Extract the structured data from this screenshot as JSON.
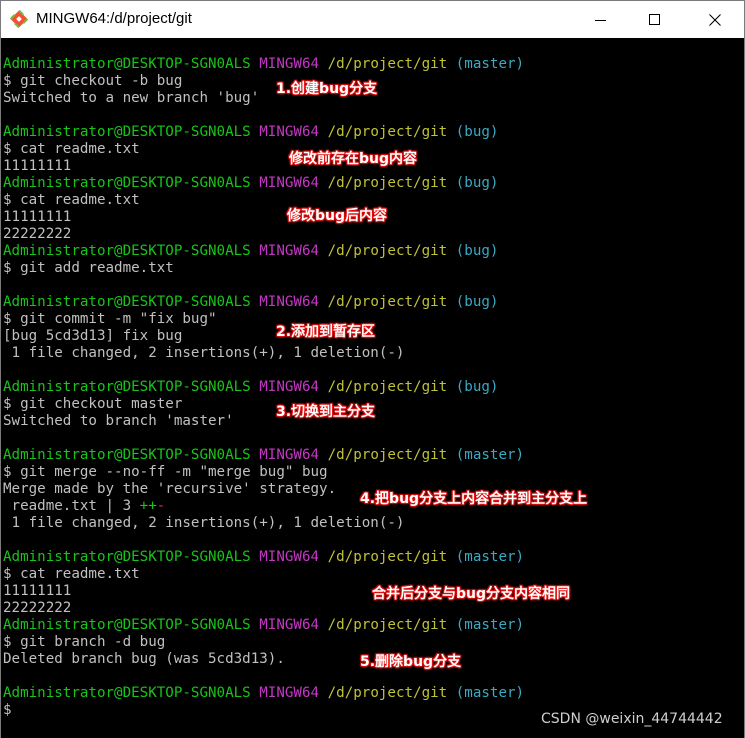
{
  "window": {
    "title": "MINGW64:/d/project/git"
  },
  "colors": {
    "user": "#18c418",
    "shell": "#c437c4",
    "path": "#c1c136",
    "branch": "#3aa9c4",
    "text": "#c0c0c0",
    "annotation_outline": "#e01010"
  },
  "prompt": {
    "user": "Administrator@DESKTOP-SGN0ALS",
    "shell": "MINGW64",
    "path": "/d/project/git"
  },
  "terminal": {
    "p1_branch": "(master)",
    "l1": "$ git checkout -b bug",
    "l2": "Switched to a new branch 'bug'",
    "p2_branch": "(bug)",
    "l3": "$ cat readme.txt",
    "l4": "11111111",
    "p3_branch": "(bug)",
    "l5": "$ cat readme.txt",
    "l6": "11111111",
    "l7": "22222222",
    "p4_branch": "(bug)",
    "l8": "$ git add readme.txt",
    "p5_branch": "(bug)",
    "l9": "$ git commit -m \"fix bug\"",
    "l10": "[bug 5cd3d13] fix bug",
    "l11": " 1 file changed, 2 insertions(+), 1 deletion(-)",
    "p6_branch": "(bug)",
    "l12": "$ git checkout master",
    "l13": "Switched to branch 'master'",
    "p7_branch": "(master)",
    "l14": "$ git merge --no-ff -m \"merge bug\" bug",
    "l15": "Merge made by the 'recursive' strategy.",
    "l16a": " readme.txt | 3 ",
    "l16b": "++",
    "l16c": "-",
    "l17": " 1 file changed, 2 insertions(+), 1 deletion(-)",
    "p8_branch": "(master)",
    "l18": "$ cat readme.txt",
    "l19": "11111111",
    "l20": "22222222",
    "p9_branch": "(master)",
    "l21": "$ git branch -d bug",
    "l22": "Deleted branch bug (was 5cd3d13).",
    "p10_branch": "(master)",
    "l23": "$"
  },
  "annotations": {
    "a1": "1.创建bug分支",
    "a2": "修改前存在bug内容",
    "a3": "修改bug后内容",
    "a4": "2.添加到暂存区",
    "a5": "3.切换到主分支",
    "a6": "4.把bug分支上内容合并到主分支上",
    "a7": "合并后分支与bug分支内容相同",
    "a8": "5.删除bug分支"
  },
  "watermark": "CSDN @weixin_44744442"
}
